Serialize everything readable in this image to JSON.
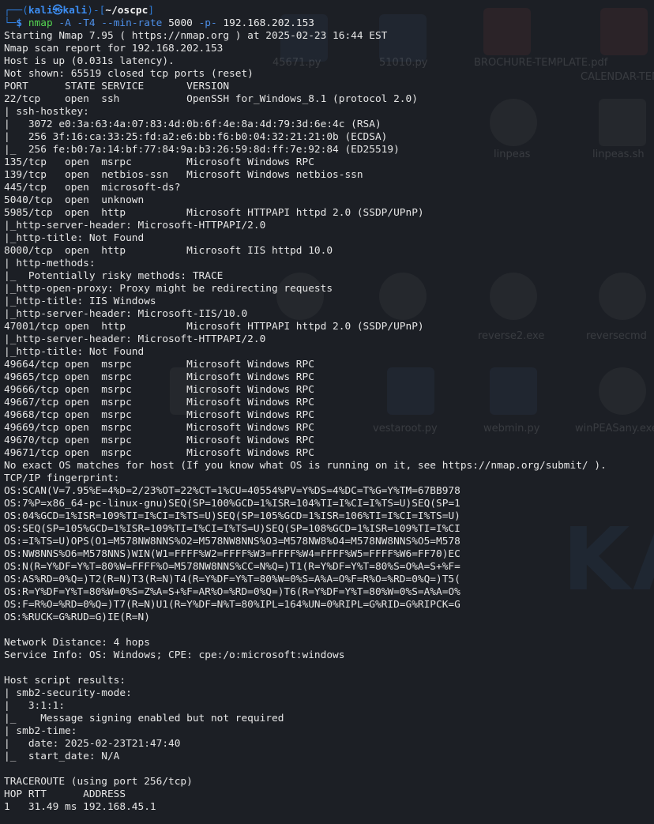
{
  "prompt": {
    "top_left": "┌──(",
    "user": "kali㉿kali",
    "mid": ")-[",
    "path": "~/oscpc",
    "end": "]",
    "bottom": "└─",
    "symbol": "$ ",
    "command_name": "nmap",
    "command_flags": " -A -T4 --min-rate",
    "command_rate": " 5000 ",
    "command_port_flag": "-p-",
    "command_target": " 192.168.202.153"
  },
  "output_lines": [
    "Starting Nmap 7.95 ( https://nmap.org ) at 2025-02-23 16:44 EST",
    "Nmap scan report for 192.168.202.153",
    "Host is up (0.031s latency).",
    "Not shown: 65519 closed tcp ports (reset)",
    "PORT      STATE SERVICE       VERSION",
    "22/tcp    open  ssh           OpenSSH for_Windows_8.1 (protocol 2.0)",
    "| ssh-hostkey:",
    "|   3072 e0:3a:63:4a:07:83:4d:0b:6f:4e:8a:4d:79:3d:6e:4c (RSA)",
    "|   256 3f:16:ca:33:25:fd:a2:e6:bb:f6:b0:04:32:21:21:0b (ECDSA)",
    "|_  256 fe:b0:7a:14:bf:77:84:9a:b3:26:59:8d:ff:7e:92:84 (ED25519)",
    "135/tcp   open  msrpc         Microsoft Windows RPC",
    "139/tcp   open  netbios-ssn   Microsoft Windows netbios-ssn",
    "445/tcp   open  microsoft-ds?",
    "5040/tcp  open  unknown",
    "5985/tcp  open  http          Microsoft HTTPAPI httpd 2.0 (SSDP/UPnP)",
    "|_http-server-header: Microsoft-HTTPAPI/2.0",
    "|_http-title: Not Found",
    "8000/tcp  open  http          Microsoft IIS httpd 10.0",
    "| http-methods:",
    "|_  Potentially risky methods: TRACE",
    "|_http-open-proxy: Proxy might be redirecting requests",
    "|_http-title: IIS Windows",
    "|_http-server-header: Microsoft-IIS/10.0",
    "47001/tcp open  http          Microsoft HTTPAPI httpd 2.0 (SSDP/UPnP)",
    "|_http-server-header: Microsoft-HTTPAPI/2.0",
    "|_http-title: Not Found",
    "49664/tcp open  msrpc         Microsoft Windows RPC",
    "49665/tcp open  msrpc         Microsoft Windows RPC",
    "49666/tcp open  msrpc         Microsoft Windows RPC",
    "49667/tcp open  msrpc         Microsoft Windows RPC",
    "49668/tcp open  msrpc         Microsoft Windows RPC",
    "49669/tcp open  msrpc         Microsoft Windows RPC",
    "49670/tcp open  msrpc         Microsoft Windows RPC",
    "49671/tcp open  msrpc         Microsoft Windows RPC",
    "No exact OS matches for host (If you know what OS is running on it, see https://nmap.org/submit/ ).",
    "TCP/IP fingerprint:",
    "OS:SCAN(V=7.95%E=4%D=2/23%OT=22%CT=1%CU=40554%PV=Y%DS=4%DC=T%G=Y%TM=67BB978",
    "OS:7%P=x86_64-pc-linux-gnu)SEQ(SP=100%GCD=1%ISR=104%TI=I%CI=I%TS=U)SEQ(SP=1",
    "OS:04%GCD=1%ISR=109%TI=I%CI=I%TS=U)SEQ(SP=105%GCD=1%ISR=106%TI=I%CI=I%TS=U)",
    "OS:SEQ(SP=105%GCD=1%ISR=109%TI=I%CI=I%TS=U)SEQ(SP=108%GCD=1%ISR=109%TI=I%CI",
    "OS:=I%TS=U)OPS(O1=M578NW8NNS%O2=M578NW8NNS%O3=M578NW8%O4=M578NW8NNS%O5=M578",
    "OS:NW8NNS%O6=M578NNS)WIN(W1=FFFF%W2=FFFF%W3=FFFF%W4=FFFF%W5=FFFF%W6=FF70)EC",
    "OS:N(R=Y%DF=Y%T=80%W=FFFF%O=M578NW8NNS%CC=N%Q=)T1(R=Y%DF=Y%T=80%S=O%A=S+%F=",
    "OS:AS%RD=0%Q=)T2(R=N)T3(R=N)T4(R=Y%DF=Y%T=80%W=0%S=A%A=O%F=R%O=%RD=0%Q=)T5(",
    "OS:R=Y%DF=Y%T=80%W=0%S=Z%A=S+%F=AR%O=%RD=0%Q=)T6(R=Y%DF=Y%T=80%W=0%S=A%A=O%",
    "OS:F=R%O=%RD=0%Q=)T7(R=N)U1(R=Y%DF=N%T=80%IPL=164%UN=0%RIPL=G%RID=G%RIPCK=G",
    "OS:%RUCK=G%RUD=G)IE(R=N)",
    "",
    "Network Distance: 4 hops",
    "Service Info: OS: Windows; CPE: cpe:/o:microsoft:windows",
    "",
    "Host script results:",
    "| smb2-security-mode:",
    "|   3:1:1:",
    "|_    Message signing enabled but not required",
    "| smb2-time:",
    "|   date: 2025-02-23T21:47:40",
    "|_  start_date: N/A",
    "",
    "TRACEROUTE (using port 256/tcp)",
    "HOP RTT      ADDRESS",
    "1   31.49 ms 192.168.45.1"
  ],
  "background_desktop_labels": [
    "45671.py",
    "51010.py",
    "BROCHURE-TEMPLATE.pdf",
    "CALENDAR-TEMPLATE.pdf",
    "linpeas",
    "linpeas.sh",
    "reverse2.exe",
    "reversecmd",
    "vestaroot.py",
    "webmin.py",
    "winPEASany.exe",
    "KALI"
  ],
  "colors": {
    "background": "#1c1f25",
    "prompt_frame": "#2f7bd6",
    "prompt_user": "#3c8df2",
    "command": "#55d651",
    "flags": "#4d8fe8",
    "text": "#e6e6e6"
  }
}
